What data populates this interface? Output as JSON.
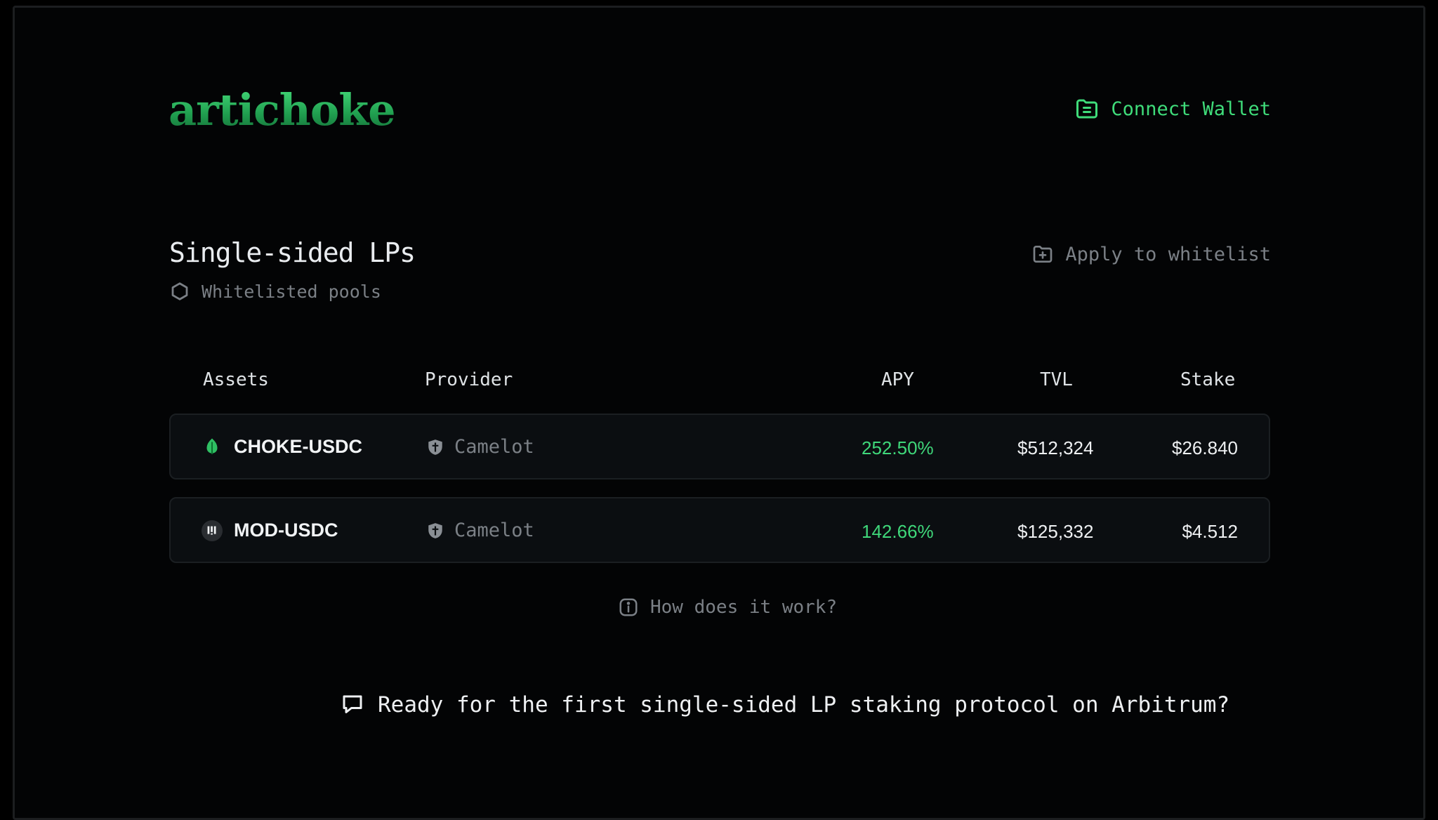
{
  "header": {
    "logo": "artichoke",
    "connect_label": "Connect Wallet"
  },
  "section": {
    "title": "Single-sided LPs",
    "subtitle": "Whitelisted pools",
    "apply_label": "Apply to whitelist"
  },
  "table": {
    "columns": [
      "Assets",
      "Provider",
      "APY",
      "TVL",
      "Stake"
    ],
    "rows": [
      {
        "asset": "CHOKE-USDC",
        "provider": "Camelot",
        "apy": "252.50%",
        "tvl": "$512,324",
        "stake": "$26.840"
      },
      {
        "asset": "MOD-USDC",
        "provider": "Camelot",
        "apy": "142.66%",
        "tvl": "$125,332",
        "stake": "$4.512"
      }
    ]
  },
  "help_label": "How does it work?",
  "cta": "Ready for the first single-sided LP staking protocol on Arbitrum?",
  "colors": {
    "accent": "#3fdc7a",
    "background": "#030405",
    "muted": "#7b8086"
  }
}
